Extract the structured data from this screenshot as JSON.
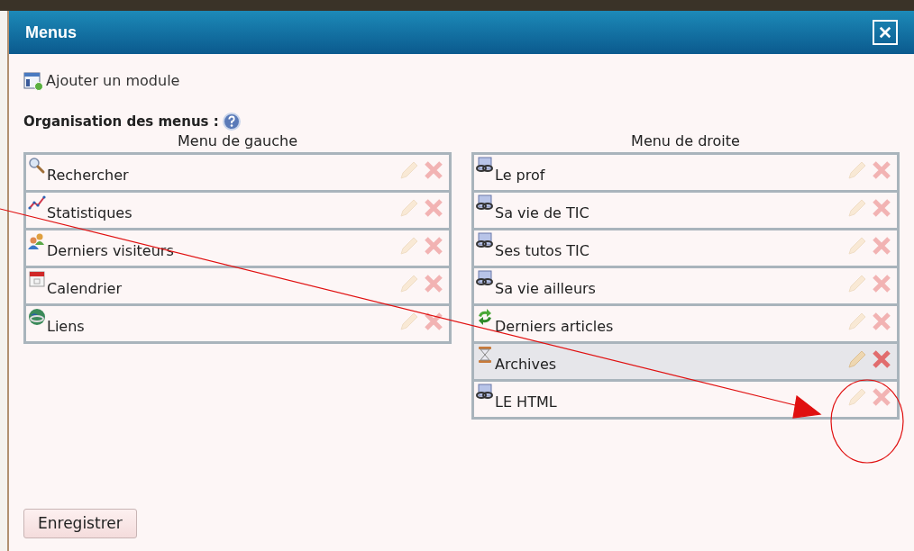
{
  "window": {
    "title": "Menus"
  },
  "add_module": {
    "label": "Ajouter un module"
  },
  "section": {
    "title": "Organisation des menus :"
  },
  "left_menu": {
    "heading": "Menu de gauche",
    "items": [
      {
        "label": "Rechercher",
        "kind": "search",
        "selected": false
      },
      {
        "label": "Statistiques",
        "kind": "stats",
        "selected": false
      },
      {
        "label": "Derniers visiteurs",
        "kind": "visitors",
        "selected": false
      },
      {
        "label": "Calendrier",
        "kind": "calendar",
        "selected": false
      },
      {
        "label": "Liens",
        "kind": "links",
        "selected": false
      }
    ]
  },
  "right_menu": {
    "heading": "Menu de droite",
    "items": [
      {
        "label": "Le prof",
        "kind": "page",
        "selected": false
      },
      {
        "label": "Sa vie de TIC",
        "kind": "page",
        "selected": false
      },
      {
        "label": "Ses tutos TIC",
        "kind": "page",
        "selected": false
      },
      {
        "label": "Sa vie ailleurs",
        "kind": "page",
        "selected": false
      },
      {
        "label": "Derniers articles",
        "kind": "articles",
        "selected": false
      },
      {
        "label": "Archives",
        "kind": "archives",
        "selected": true
      },
      {
        "label": "LE HTML",
        "kind": "page",
        "selected": false
      }
    ]
  },
  "buttons": {
    "save": "Enregistrer"
  }
}
